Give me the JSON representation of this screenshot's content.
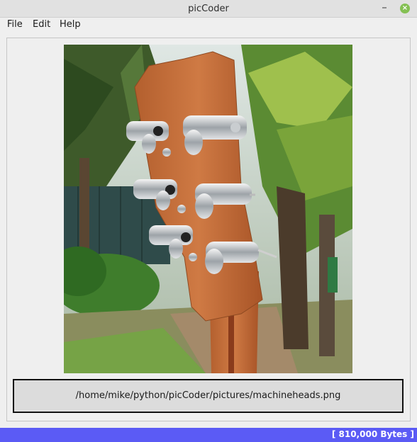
{
  "window": {
    "title": "picCoder"
  },
  "menu": {
    "items": [
      "File",
      "Edit",
      "Help"
    ]
  },
  "image": {
    "path": "/home/mike/python/picCoder/pictures/machineheads.png"
  },
  "status": {
    "text": "[ 810,000 Bytes ]"
  },
  "titlebar": {
    "minimize": "–",
    "close": "×"
  },
  "colors": {
    "status_bar": "#5b5bf5",
    "close_button": "#84c053"
  },
  "icons": [
    "minimize-icon",
    "close-icon"
  ]
}
